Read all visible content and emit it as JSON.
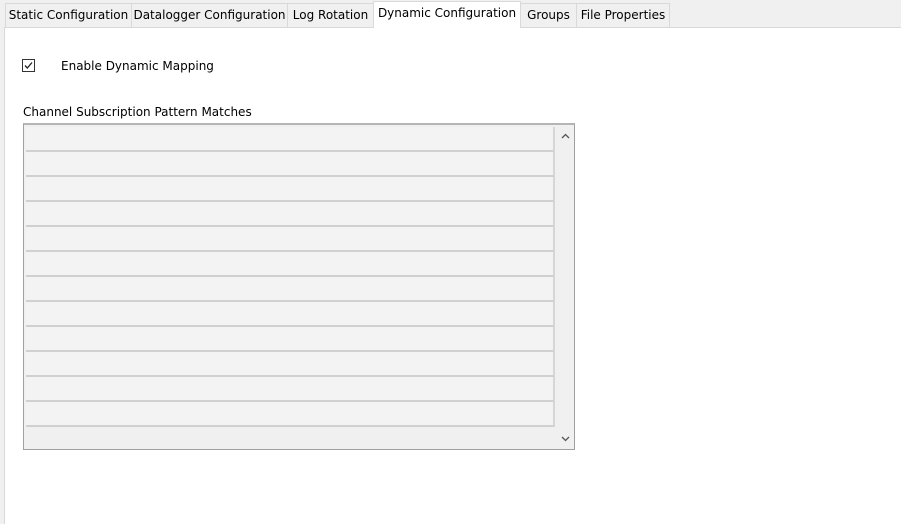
{
  "tabs": [
    {
      "label": "Static Configuration",
      "active": false
    },
    {
      "label": "Datalogger Configuration",
      "active": false
    },
    {
      "label": "Log Rotation",
      "active": false
    },
    {
      "label": "Dynamic Configuration",
      "active": true
    },
    {
      "label": "Groups",
      "active": false
    },
    {
      "label": "File Properties",
      "active": false
    }
  ],
  "dynamic": {
    "enable_mapping_label": "Enable Dynamic Mapping",
    "enable_mapping_checked": true,
    "pattern_list_label": "Channel Subscription Pattern Matches",
    "pattern_rows": [
      "",
      "",
      "",
      "",
      "",
      "",
      "",
      "",
      "",
      "",
      "",
      ""
    ]
  },
  "icons": {
    "checkbox_check": "check-icon",
    "scroll_up": "chevron-up-icon",
    "scroll_down": "chevron-down-icon"
  }
}
